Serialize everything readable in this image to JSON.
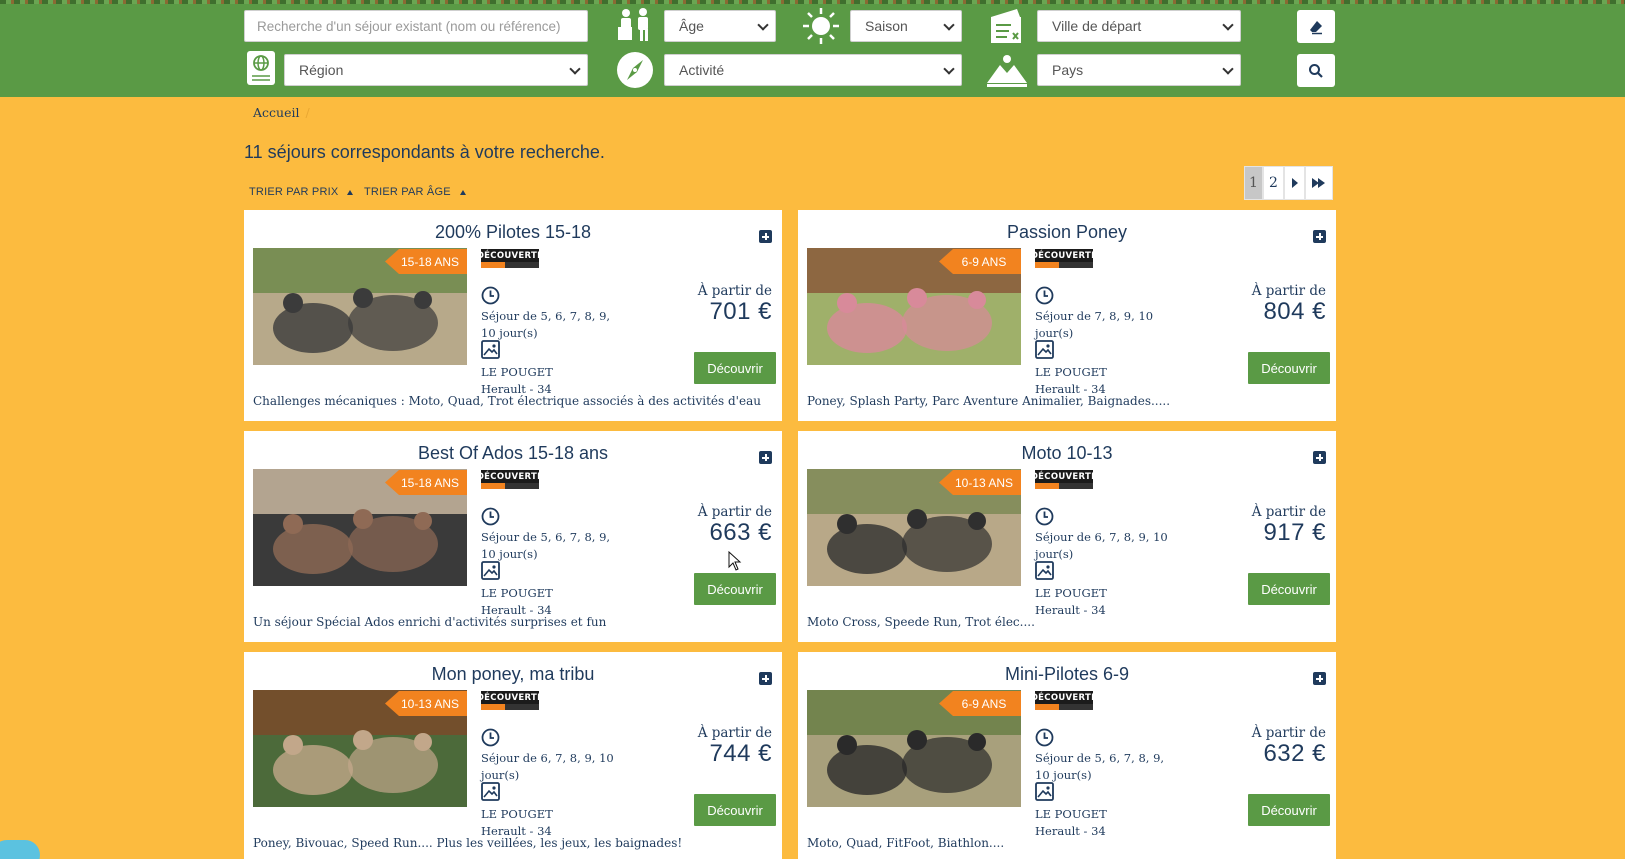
{
  "header": {
    "search": {
      "placeholder": "Recherche d'un séjour existant (nom ou référence)"
    },
    "filters": {
      "age": "Âge",
      "season": "Saison",
      "departure_city": "Ville de départ",
      "region": "Région",
      "activity": "Activité",
      "country": "Pays"
    },
    "icons": [
      "family-icon",
      "sun-icon",
      "ticket-icon",
      "globe-sign-icon",
      "compass-icon",
      "mountain-icon",
      "eraser-icon",
      "search-icon"
    ]
  },
  "breadcrumb": {
    "home": "Accueil",
    "separator": "/"
  },
  "results_text": "11 séjours correspondants à votre recherche.",
  "sort": {
    "by_price": "TRIER PAR PRIX",
    "by_age": "TRIER PAR ÂGE"
  },
  "pagination": {
    "pages": [
      "1",
      "2"
    ],
    "current": "1",
    "next": "›",
    "last": "»"
  },
  "cards": [
    {
      "title": "200% Pilotes 15-18",
      "age": "15-18 ANS",
      "badge": "DÉCOUVERTE",
      "duration": "Séjour de 5, 6, 7, 8, 9, 10 jour(s)",
      "place": "LE POUGET",
      "dept": "Herault - 34",
      "price_prefix": "À partir de",
      "price": "701 €",
      "button": "Découvrir",
      "desc": "Challenges mécaniques : Moto, Quad, Trot électrique associés à des activités d'eau"
    },
    {
      "title": "Passion Poney",
      "age": "6-9 ANS",
      "badge": "DÉCOUVERTE",
      "duration": "Séjour de 7, 8, 9, 10 jour(s)",
      "place": "LE POUGET",
      "dept": "Herault - 34",
      "price_prefix": "À partir de",
      "price": "804 €",
      "button": "Découvrir",
      "desc": "Poney, Splash Party, Parc Aventure Animalier, Baignades....."
    },
    {
      "title": "Best Of Ados 15-18 ans",
      "age": "15-18 ANS",
      "badge": "DÉCOUVERTE",
      "duration": "Séjour de 5, 6, 7, 8, 9, 10 jour(s)",
      "place": "LE POUGET",
      "dept": "Herault - 34",
      "price_prefix": "À partir de",
      "price": "663 €",
      "button": "Découvrir",
      "desc": "Un séjour Spécial Ados enrichi d'activités surprises et fun"
    },
    {
      "title": "Moto 10-13",
      "age": "10-13 ANS",
      "badge": "DÉCOUVERTE",
      "duration": "Séjour de 6, 7, 8, 9, 10 jour(s)",
      "place": "LE POUGET",
      "dept": "Herault - 34",
      "price_prefix": "À partir de",
      "price": "917 €",
      "button": "Découvrir",
      "desc": "Moto Cross, Speede Run, Trot élec...."
    },
    {
      "title": "Mon poney, ma tribu",
      "age": "10-13 ANS",
      "badge": "DÉCOUVERTE",
      "duration": "Séjour de 6, 7, 8, 9, 10 jour(s)",
      "place": "LE POUGET",
      "dept": "Herault - 34",
      "price_prefix": "À partir de",
      "price": "744 €",
      "button": "Découvrir",
      "desc": "Poney, Bivouac, Speed Run.... Plus les veillées, les jeux, les baignades!"
    },
    {
      "title": "Mini-Pilotes 6-9",
      "age": "6-9 ANS",
      "badge": "DÉCOUVERTE",
      "duration": "Séjour de 5, 6, 7, 8, 9, 10 jour(s)",
      "place": "LE POUGET",
      "dept": "Herault - 34",
      "price_prefix": "À partir de",
      "price": "632 €",
      "button": "Découvrir",
      "desc": "Moto,  Quad, FitFoot, Biathlon...."
    }
  ],
  "colors": {
    "header_green": "#5a9a45",
    "page_yellow": "#fcbb3f",
    "ribbon_orange": "#f2831f",
    "text_navy": "#1f3a5c"
  }
}
